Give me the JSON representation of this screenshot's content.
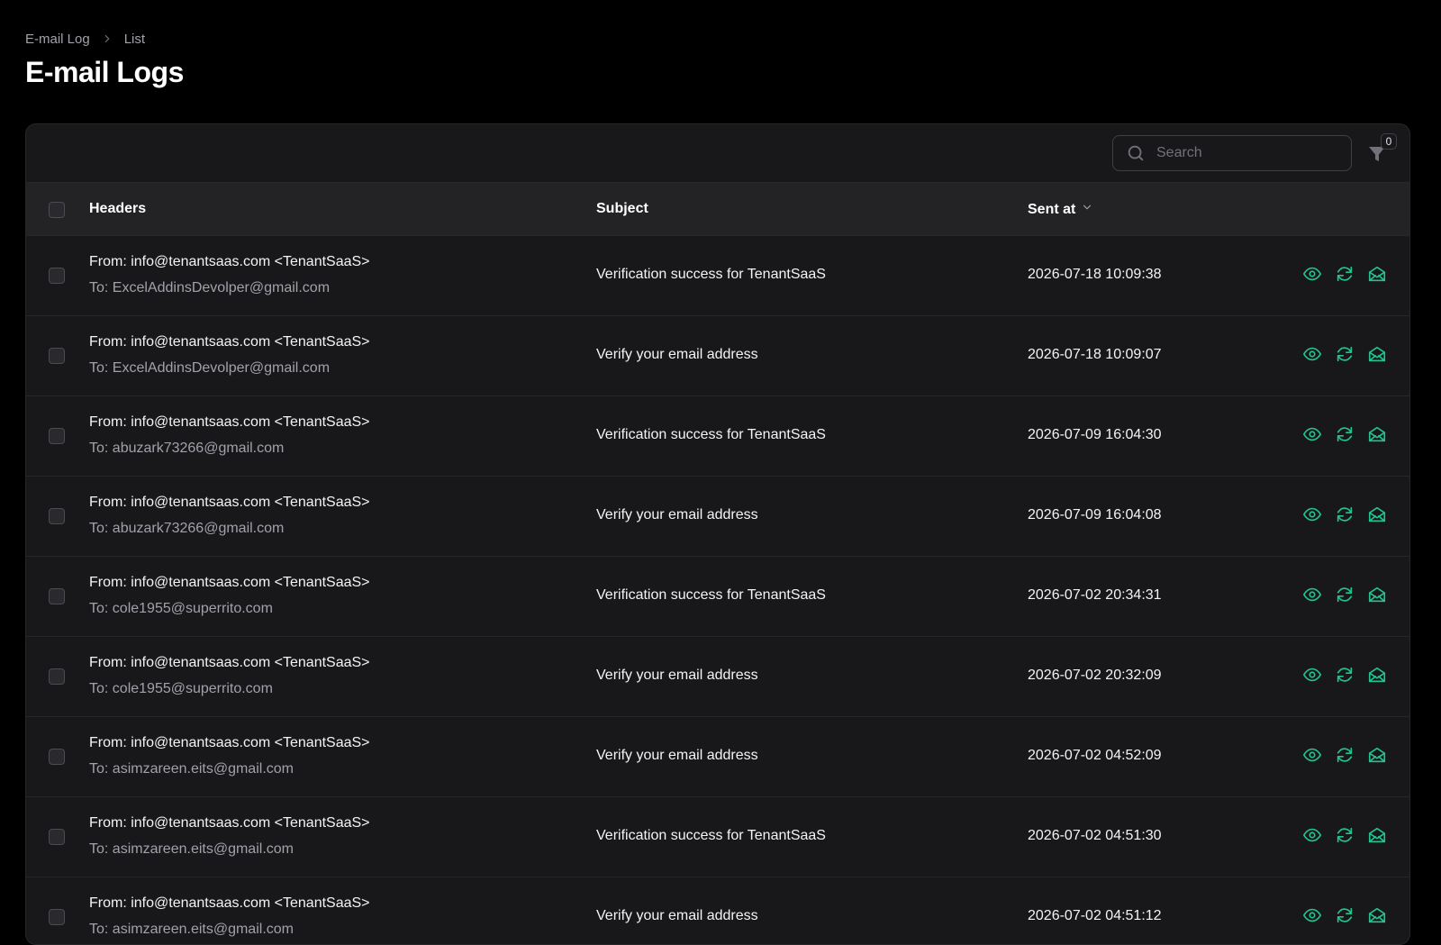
{
  "breadcrumb": {
    "parent": "E-mail Log",
    "current": "List"
  },
  "page": {
    "title": "E-mail Logs"
  },
  "toolbar": {
    "search_placeholder": "Search",
    "filter_count": "0"
  },
  "table": {
    "columns": {
      "headers": "Headers",
      "subject": "Subject",
      "sent_at": "Sent at"
    },
    "rows": [
      {
        "from": "From: info@tenantsaas.com <TenantSaaS>",
        "to": "To: ExcelAddinsDevolper@gmail.com",
        "subject": "Verification success for TenantSaaS",
        "sent_at": "2026-07-18 10:09:38"
      },
      {
        "from": "From: info@tenantsaas.com <TenantSaaS>",
        "to": "To: ExcelAddinsDevolper@gmail.com",
        "subject": "Verify your email address",
        "sent_at": "2026-07-18 10:09:07"
      },
      {
        "from": "From: info@tenantsaas.com <TenantSaaS>",
        "to": "To: abuzark73266@gmail.com",
        "subject": "Verification success for TenantSaaS",
        "sent_at": "2026-07-09 16:04:30"
      },
      {
        "from": "From: info@tenantsaas.com <TenantSaaS>",
        "to": "To: abuzark73266@gmail.com",
        "subject": "Verify your email address",
        "sent_at": "2026-07-09 16:04:08"
      },
      {
        "from": "From: info@tenantsaas.com <TenantSaaS>",
        "to": "To: cole1955@superrito.com",
        "subject": "Verification success for TenantSaaS",
        "sent_at": "2026-07-02 20:34:31"
      },
      {
        "from": "From: info@tenantsaas.com <TenantSaaS>",
        "to": "To: cole1955@superrito.com",
        "subject": "Verify your email address",
        "sent_at": "2026-07-02 20:32:09"
      },
      {
        "from": "From: info@tenantsaas.com <TenantSaaS>",
        "to": "To: asimzareen.eits@gmail.com",
        "subject": "Verify your email address",
        "sent_at": "2026-07-02 04:52:09"
      },
      {
        "from": "From: info@tenantsaas.com <TenantSaaS>",
        "to": "To: asimzareen.eits@gmail.com",
        "subject": "Verification success for TenantSaaS",
        "sent_at": "2026-07-02 04:51:30"
      },
      {
        "from": "From: info@tenantsaas.com <TenantSaaS>",
        "to": "To: asimzareen.eits@gmail.com",
        "subject": "Verify your email address",
        "sent_at": "2026-07-02 04:51:12"
      }
    ]
  },
  "row_actions": [
    "eye-icon",
    "refresh-icon",
    "envelope-open-icon"
  ],
  "colors": {
    "background": "#000000",
    "panel": "#18181b",
    "accent": "#22c38e",
    "muted_text": "#a1a1aa"
  }
}
